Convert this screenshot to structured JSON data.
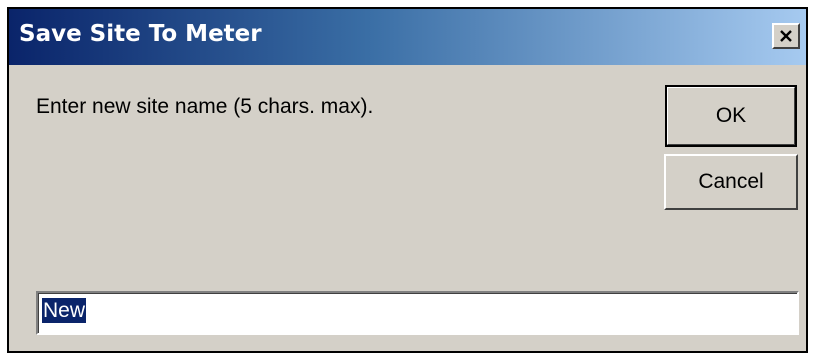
{
  "window": {
    "title": "Save Site To Meter",
    "close_icon": "close-x-icon"
  },
  "prompt": {
    "text": "Enter new site name (5 chars. max)."
  },
  "buttons": {
    "ok_label": "OK",
    "cancel_label": "Cancel"
  },
  "input": {
    "value": "New",
    "selected": true
  },
  "colors": {
    "title_gradient_start": "#0a246a",
    "title_gradient_end": "#a6caf0",
    "dialog_face": "#d4d0c8",
    "selection": "#0a246a"
  }
}
